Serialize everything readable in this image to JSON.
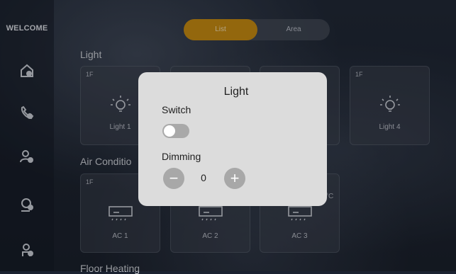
{
  "sidebar": {
    "brand": "WELCOME",
    "items": [
      {
        "icon": "home-icon"
      },
      {
        "icon": "phone-icon"
      },
      {
        "icon": "user-group-icon"
      },
      {
        "icon": "user-settings-icon"
      },
      {
        "icon": "user-info-icon"
      }
    ]
  },
  "tabs": {
    "list_label": "List",
    "area_label": "Area",
    "selected": "List",
    "accent": "#c48a12"
  },
  "sections": {
    "light": "Light",
    "air": "Air Conditio",
    "floor": "Floor Heating"
  },
  "light_cards": [
    {
      "floor": "1F",
      "name": "Light 1"
    },
    {
      "floor": "1F",
      "name": "Light 4"
    }
  ],
  "ac_cards": [
    {
      "floor": "1F",
      "name": "AC 1"
    },
    {
      "name": "AC 2"
    },
    {
      "name": "AC 3",
      "temp_unit": "°C"
    }
  ],
  "modal": {
    "title": "Light",
    "switch_label": "Switch",
    "switch_on": false,
    "dimming_label": "Dimming",
    "dimming_value": "0",
    "minus": "−",
    "plus": "+"
  }
}
